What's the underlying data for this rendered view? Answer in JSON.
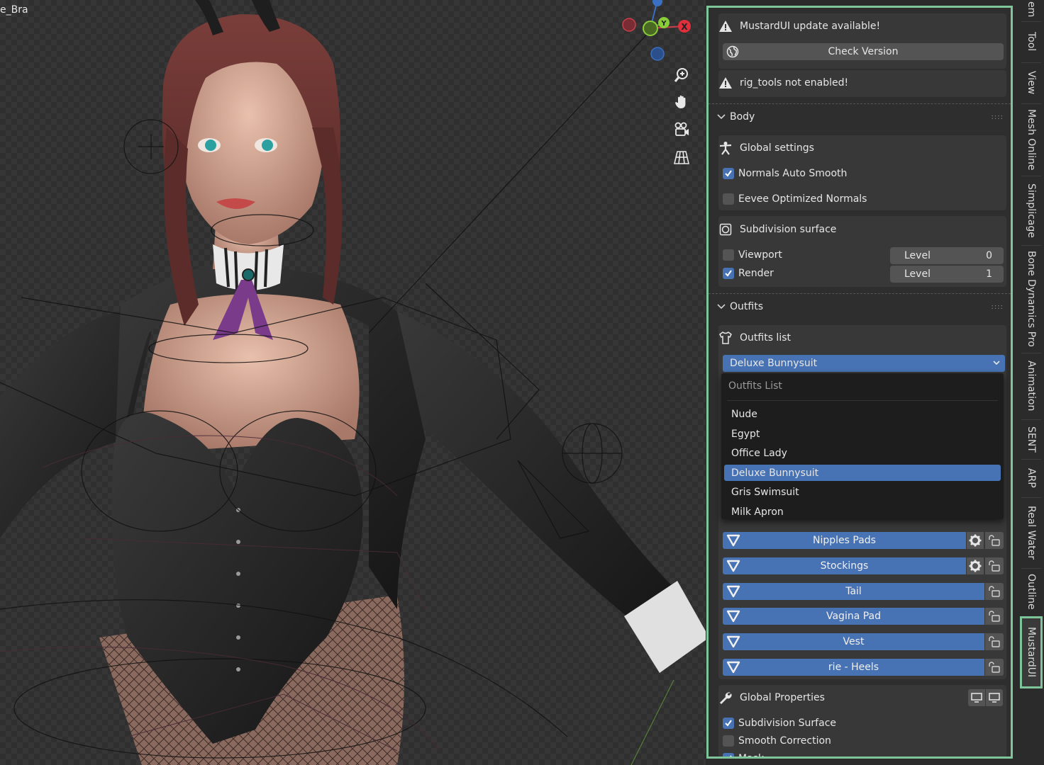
{
  "viewport": {
    "corner_label": "e_Bra",
    "gizmo": {
      "x_label": "X",
      "y_label": "Y"
    },
    "nav_icons": [
      "zoom-icon",
      "hand-icon",
      "camera-icon",
      "grid-icon"
    ]
  },
  "panel": {
    "update_msg": "MustardUI update available!",
    "check_version": "Check Version",
    "rig_warning": "rig_tools not enabled!",
    "body": {
      "title": "Body",
      "global_settings": "Global settings",
      "normals_auto_smooth": {
        "label": "Normals Auto Smooth",
        "checked": true
      },
      "eevee_optimized": {
        "label": "Eevee Optimized Normals",
        "checked": false
      },
      "subdivision_surface": "Subdivision surface",
      "viewport": {
        "label": "Viewport",
        "checked": false,
        "level_label": "Level",
        "level": "0"
      },
      "render": {
        "label": "Render",
        "checked": true,
        "level_label": "Level",
        "level": "1"
      }
    },
    "outfits": {
      "title": "Outfits",
      "list_label": "Outfits list",
      "selected": "Deluxe Bunnysuit",
      "dropdown_title": "Outfits List",
      "options": [
        "Nude",
        "Egypt",
        "Office Lady",
        "Deluxe Bunnysuit",
        "Gris Swimsuit",
        "Milk Apron"
      ],
      "items": [
        {
          "label": "Nipples Pads",
          "gear": true
        },
        {
          "label": "Stockings",
          "gear": true
        },
        {
          "label": "Tail",
          "gear": false
        },
        {
          "label": "Vagina Pad",
          "gear": false
        },
        {
          "label": "Vest",
          "gear": false
        },
        {
          "label": "rie - Heels",
          "gear": false
        }
      ]
    },
    "global_properties": {
      "title": "Global Properties",
      "subdivision": {
        "label": "Subdivision Surface",
        "checked": true
      },
      "smooth": {
        "label": "Smooth Correction",
        "checked": false
      },
      "mask": {
        "label": "Mask",
        "checked": true
      }
    }
  },
  "tabs": [
    "em",
    "Tool",
    "View",
    "Mesh Online",
    "Simplicage",
    "Bone Dynamics Pro",
    "Animation",
    "SENT",
    "ARP",
    "Real Water",
    "Outline",
    "MustardUI"
  ],
  "colors": {
    "accent": "#4772b3",
    "highlight": "#7fc59a",
    "panel_bg": "#2e2e2e"
  }
}
